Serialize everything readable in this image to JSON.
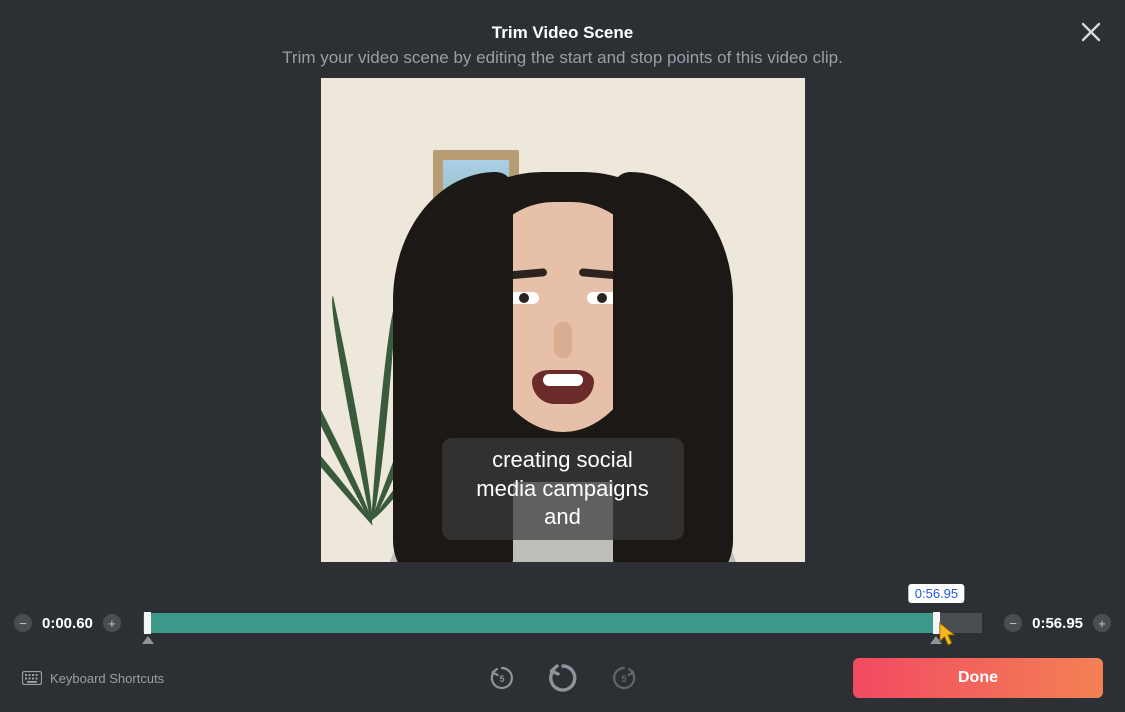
{
  "header": {
    "title": "Trim Video Scene",
    "subtitle": "Trim your video scene by editing the start and stop points of this video clip."
  },
  "caption": "creating social media campaigns and",
  "timeline": {
    "start_time": "0:00.60",
    "end_time": "0:56.95",
    "tooltip_time": "0:56.95",
    "start_percent": 0.5,
    "end_percent": 94.5
  },
  "footer": {
    "shortcuts_label": "Keyboard Shortcuts",
    "done_label": "Done"
  },
  "icons": {
    "minus": "−",
    "plus": "+"
  }
}
